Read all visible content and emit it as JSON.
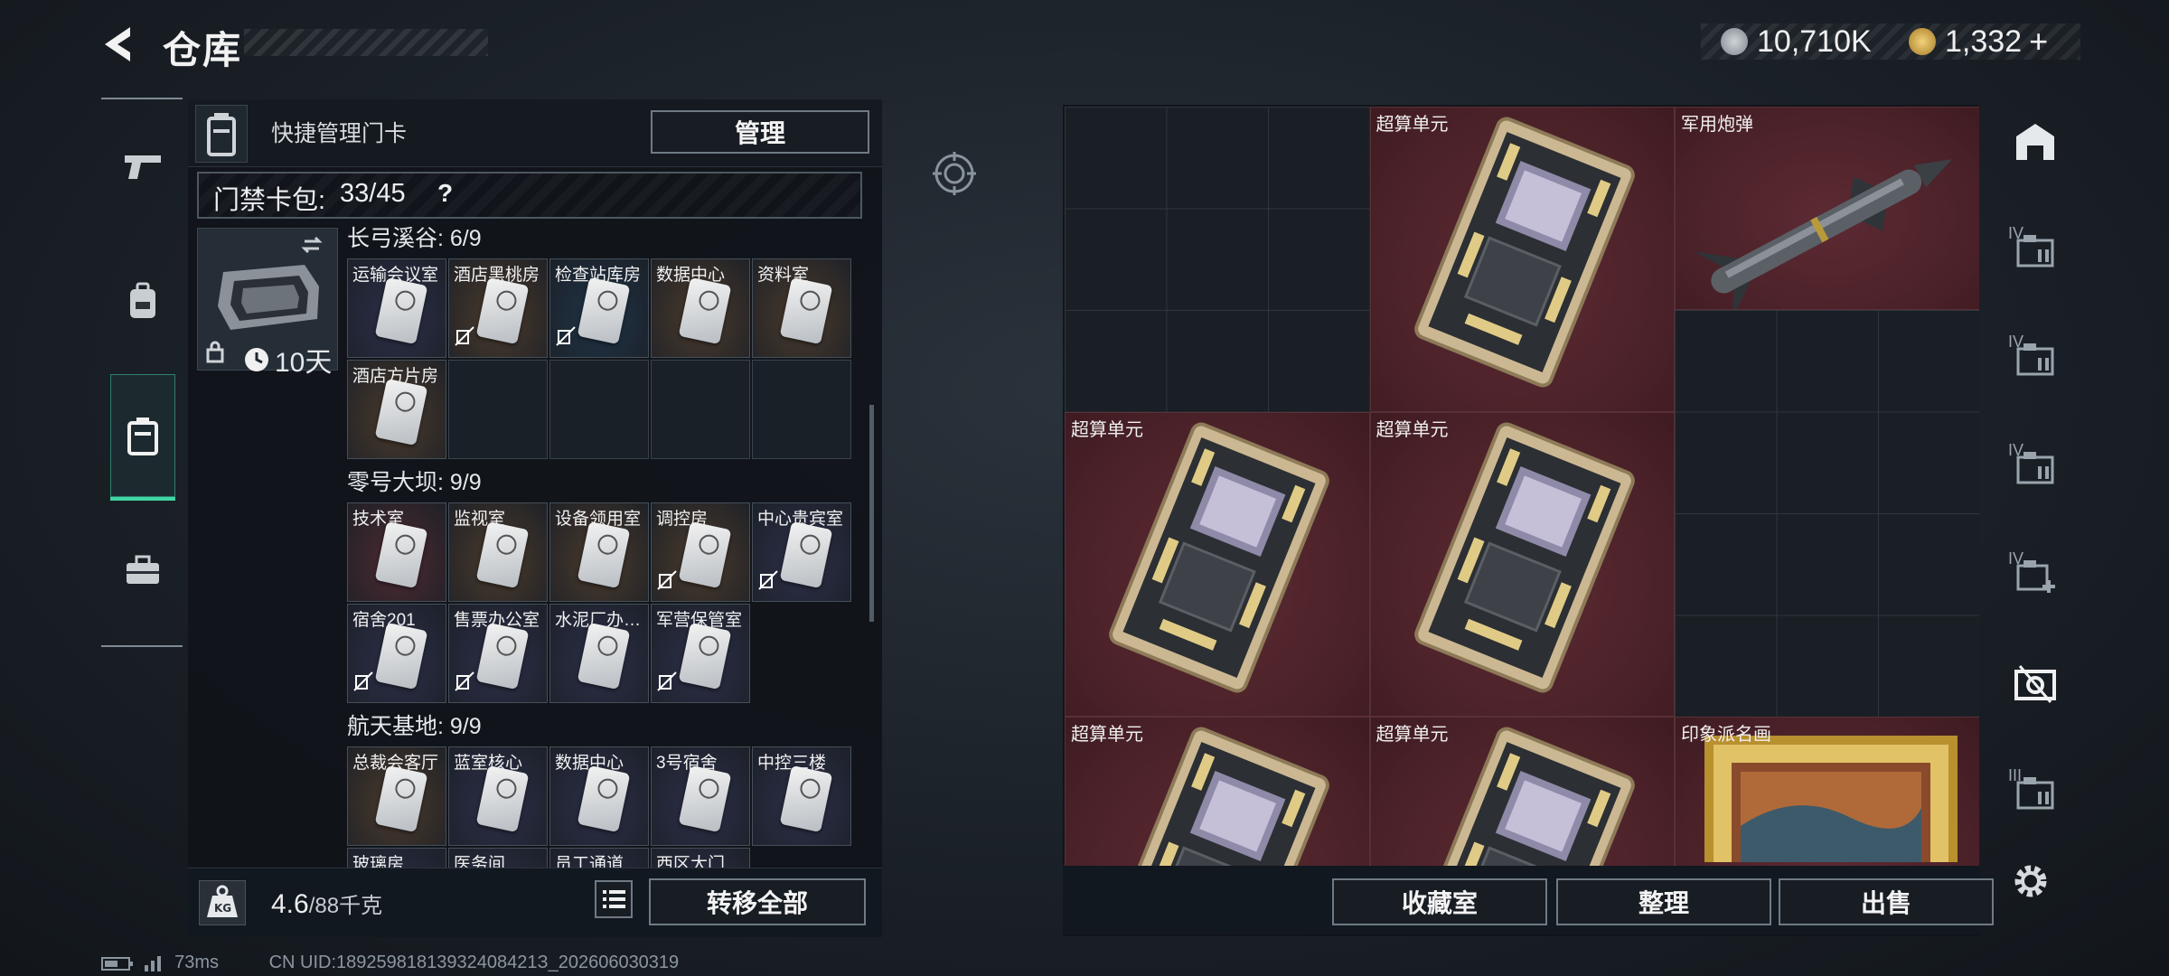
{
  "header": {
    "title": "仓库"
  },
  "currency": {
    "silver": "10,710K",
    "gold": "1,332",
    "plus": "+"
  },
  "left_panel": {
    "quick_label": "快捷管理门卡",
    "manage_button": "管理",
    "pack": {
      "label": "门禁卡包:",
      "value": "33/45",
      "help": "?"
    },
    "case_duration": "10天",
    "regions": [
      {
        "name": "长弓溪谷: 6/9",
        "cards": [
          {
            "label": "运输会议室",
            "tint": "#2c2f48",
            "noswap": false
          },
          {
            "label": "酒店黑桃房",
            "tint": "#4a3a2c",
            "noswap": true
          },
          {
            "label": "检查站库房",
            "tint": "#1f3346",
            "noswap": true
          },
          {
            "label": "数据中心",
            "tint": "#4a3a2c",
            "noswap": false
          },
          {
            "label": "资料室",
            "tint": "#4a3a2c",
            "noswap": false
          },
          {
            "label": "酒店方片房",
            "tint": "#4a3a2c",
            "noswap": false
          }
        ]
      },
      {
        "name": "零号大坝: 9/9",
        "cards": [
          {
            "label": "技术室",
            "tint": "#4d2a31",
            "noswap": false
          },
          {
            "label": "监视室",
            "tint": "#4a3a2c",
            "noswap": false
          },
          {
            "label": "设备领用室",
            "tint": "#4a3a2c",
            "noswap": false
          },
          {
            "label": "调控房",
            "tint": "#4a3a2c",
            "noswap": true
          },
          {
            "label": "中心贵宾室",
            "tint": "#2c2f48",
            "noswap": true
          },
          {
            "label": "宿舍201",
            "tint": "#2c2f48",
            "noswap": true
          },
          {
            "label": "售票办公室",
            "tint": "#2c2f48",
            "noswap": true
          },
          {
            "label": "水泥厂办…",
            "tint": "#2c2f48",
            "noswap": false
          },
          {
            "label": "军营保管室",
            "tint": "#2c2f48",
            "noswap": true
          }
        ]
      },
      {
        "name": "航天基地: 9/9",
        "cards": [
          {
            "label": "总裁会客厅",
            "tint": "#4a3a2c",
            "noswap": false
          },
          {
            "label": "蓝室核心",
            "tint": "#2c2f48",
            "noswap": false
          },
          {
            "label": "数据中心",
            "tint": "#2c2f48",
            "noswap": false
          },
          {
            "label": "3号宿舍",
            "tint": "#2c2f48",
            "noswap": false
          },
          {
            "label": "中控三楼",
            "tint": "#2c2f48",
            "noswap": false
          },
          {
            "label": "玻璃房",
            "tint": "#2c2f48",
            "noswap": false
          },
          {
            "label": "医务间",
            "tint": "#2c2f48",
            "noswap": false
          },
          {
            "label": "员工通道",
            "tint": "#2c2f48",
            "noswap": false
          },
          {
            "label": "西区大门",
            "tint": "#2c2f48",
            "noswap": false
          }
        ]
      }
    ],
    "weight": {
      "current": "4.6",
      "max": "/88千克"
    },
    "transfer_all": "转移全部"
  },
  "stash": {
    "items": [
      {
        "label": "超算单元",
        "kind": "board"
      },
      {
        "label": "军用炮弹",
        "kind": "missile"
      },
      {
        "label": "超算单元",
        "kind": "board"
      },
      {
        "label": "超算单元",
        "kind": "board"
      },
      {
        "label": "超算单元",
        "kind": "board"
      },
      {
        "label": "超算单元",
        "kind": "board"
      },
      {
        "label": "印象派名画",
        "kind": "painting"
      }
    ],
    "buttons": {
      "collection": "收藏室",
      "sort": "整理",
      "sell": "出售"
    }
  },
  "right_tabs": [
    {
      "icon": "house-icon",
      "level": ""
    },
    {
      "icon": "folder-stack-icon",
      "level": "IV"
    },
    {
      "icon": "folder-stack-icon",
      "level": "IV"
    },
    {
      "icon": "folder-stack-icon",
      "level": "IV"
    },
    {
      "icon": "folder-add-icon",
      "level": "IV"
    },
    {
      "icon": "crate-icon",
      "level": ""
    },
    {
      "icon": "folder-stack-icon",
      "level": "III"
    }
  ],
  "status": {
    "ping": "73ms",
    "uid": "CN UID:18925981813932408421З_202606030319"
  }
}
